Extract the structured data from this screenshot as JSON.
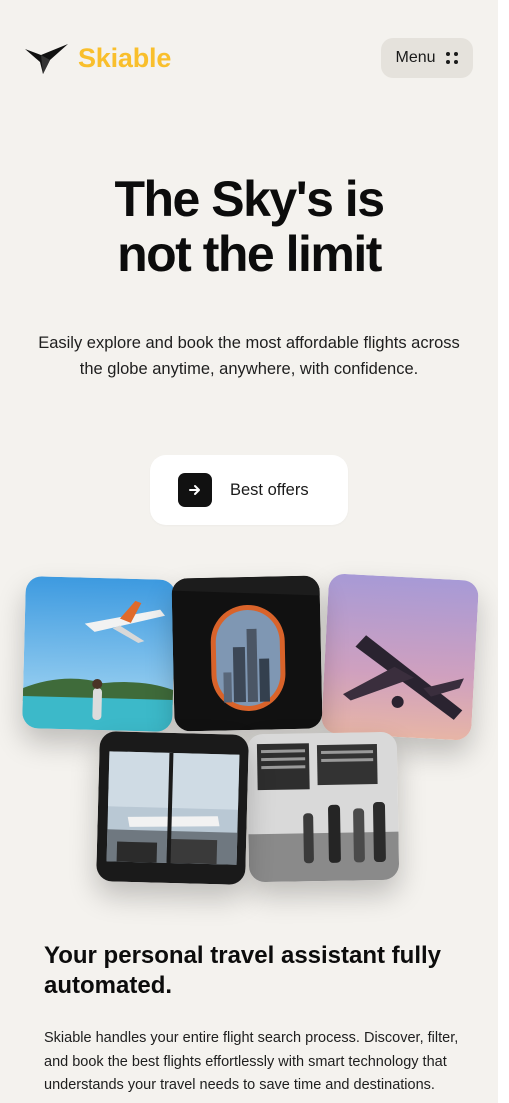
{
  "brand": {
    "name": "Skiable",
    "color": "#f9bf2c",
    "logo_icon": "bird-icon"
  },
  "nav": {
    "menu_label": "Menu",
    "menu_icon": "dots-grid-icon"
  },
  "hero": {
    "title_line1": "The Sky's is",
    "title_line2": "not the limit",
    "subtitle": "Easily explore and book the most affordable flights across the globe anytime, anywhere, with confidence.",
    "cta_label": "Best offers",
    "cta_icon": "arrow-right-icon"
  },
  "gallery": {
    "images": [
      "airplane-over-beach-photo",
      "airplane-window-city-photo",
      "airplane-takeoff-sunset-photo",
      "airport-lounge-window-photo",
      "airport-departure-board-photo"
    ]
  },
  "features": {
    "title": "Your personal travel assistant fully automated.",
    "body": "Skiable handles your entire flight search process. Discover, filter, and book the best flights effortlessly with smart technology that understands your travel needs to save time and destinations."
  },
  "colors": {
    "background": "#f4f2ee",
    "menu_bg": "#e5e2dc",
    "cta_bg": "#ffffff",
    "text": "#0c0c0c"
  }
}
